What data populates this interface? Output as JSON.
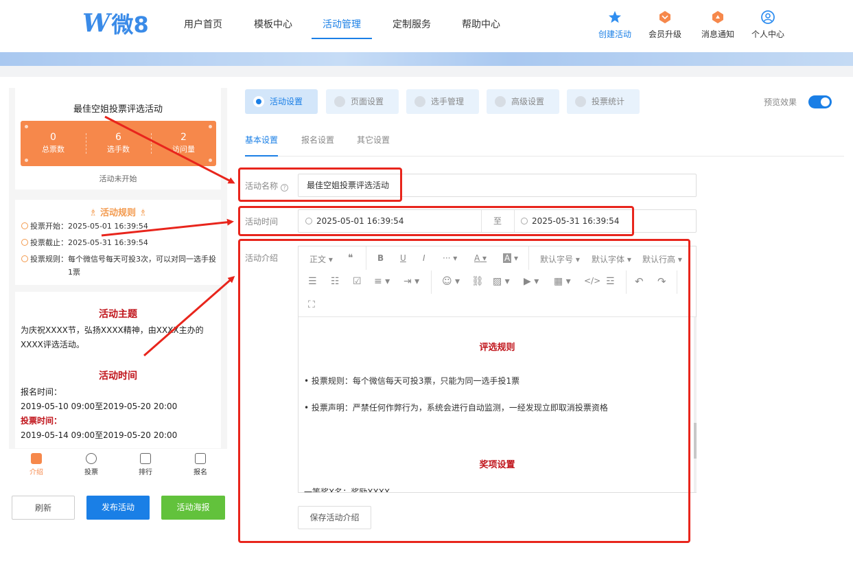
{
  "header": {
    "logo_w": "W",
    "logo_text": "微8",
    "nav": [
      "用户首页",
      "模板中心",
      "活动管理",
      "定制服务",
      "帮助中心"
    ],
    "actions": [
      {
        "label": "创建活动",
        "icon": "star-icon",
        "color": "#2f8ef0"
      },
      {
        "label": "会员升级",
        "icon": "diamond-icon",
        "color": "#f6884b"
      },
      {
        "label": "消息通知",
        "icon": "bell-icon",
        "color": "#f6884b"
      },
      {
        "label": "个人中心",
        "icon": "user-icon",
        "color": "#2f8ef0"
      }
    ]
  },
  "preview": {
    "title": "最佳空姐投票评选活动",
    "stats": [
      {
        "value": "0",
        "label": "总票数"
      },
      {
        "value": "6",
        "label": "选手数"
      },
      {
        "value": "2",
        "label": "访问量"
      }
    ],
    "status": "活动未开始",
    "rules_title": "活动规则",
    "rules": [
      {
        "label": "投票开始：",
        "value": "2025-05-01 16:39:54"
      },
      {
        "label": "投票截止：",
        "value": "2025-05-31 16:39:54"
      },
      {
        "label": "投票规则：",
        "value": "每个微信号每天可投3次，可以对同一选手投1票"
      }
    ],
    "theme_title": "活动主题",
    "theme_text": "为庆祝XXXX节，弘扬XXXX精神，由XXXX主办的XXXX评选活动。",
    "time_title": "活动时间",
    "signup_label": "报名时间：",
    "signup_value": "2019-05-10 09:00至2019-05-20 20:00",
    "vote_label": "投票时间：",
    "vote_value": "2019-05-14 09:00至2019-05-20 20:00",
    "tabbar": [
      "介绍",
      "投票",
      "排行",
      "报名"
    ],
    "buttons": {
      "refresh": "刷新",
      "publish": "发布活动",
      "poster": "活动海报"
    }
  },
  "tabs": [
    "活动设置",
    "页面设置",
    "选手管理",
    "高级设置",
    "投票统计"
  ],
  "preview_label": "预览效果",
  "preview_toggle_on": true,
  "subtabs": [
    "基本设置",
    "报名设置",
    "其它设置"
  ],
  "form": {
    "name_label": "活动名称",
    "name_value": "最佳空姐投票评选活动",
    "time_label": "活动时间",
    "start": "2025-05-01 16:39:54",
    "to": "至",
    "end": "2025-05-31 16:39:54",
    "intro_label": "活动介绍"
  },
  "toolbar": {
    "paragraph": "正文",
    "quote": "❝",
    "bold": "B",
    "underline": "U",
    "italic": "I",
    "more": "···",
    "font_color": "A",
    "bg_color": "A",
    "font_size": "默认字号",
    "font_family": "默认字体",
    "line_height": "默认行高"
  },
  "editor": {
    "rules_title": "评选规则",
    "bullets": [
      "• 投票规则：每个微信每天可投3票，只能为同一选手投1票",
      "• 投票声明：严禁任何作弊行为，系统会进行自动监测，一经发现立即取消投票资格"
    ],
    "prize_title": "奖项设置",
    "prize_line": "一等奖X名：奖励XXXX"
  },
  "save_button": "保存活动介绍",
  "colors": {
    "accent": "#1a7fe6",
    "orange": "#f6884b",
    "red_annotation": "#e8251c",
    "publish": "#1a7fe6",
    "poster": "#62c23c"
  }
}
